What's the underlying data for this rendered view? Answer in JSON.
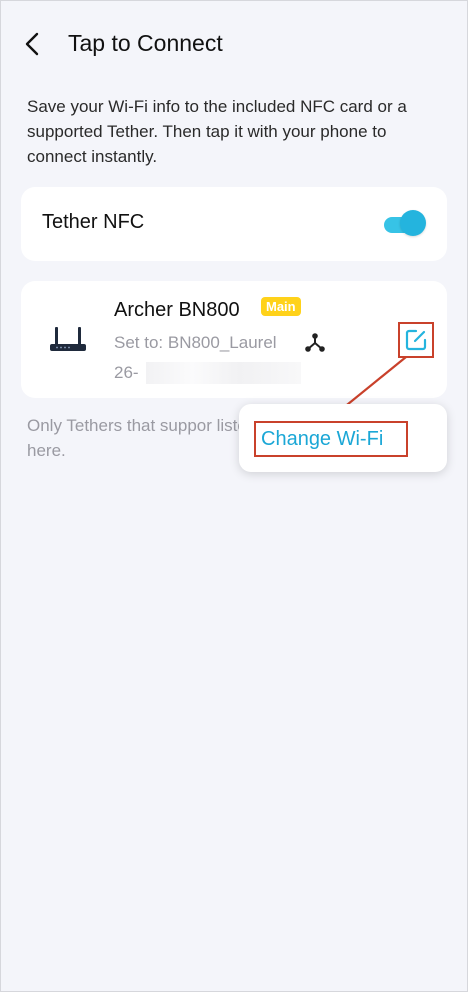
{
  "header": {
    "title": "Tap to Connect"
  },
  "description": "Save your Wi-Fi info to the included NFC card or a supported Tether. Then tap it with your phone to connect instantly.",
  "nfc": {
    "label": "Tether NFC",
    "enabled": true
  },
  "device": {
    "name": "Archer BN800",
    "badge": "Main",
    "set_to": "Set to: BN800_Laurel",
    "serial_prefix": "26-"
  },
  "note": "Only Tethers that suppor listed here.",
  "popup": {
    "item": "Change Wi-Fi"
  },
  "colors": {
    "accent": "#24b4de",
    "badge": "#ffd21a",
    "annotation": "#c9412b"
  }
}
